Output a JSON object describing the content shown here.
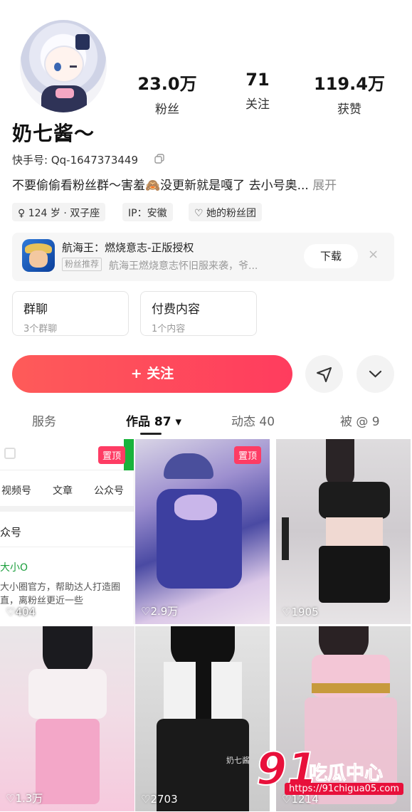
{
  "profile": {
    "name": "奶七酱～",
    "kuaishou_id": "快手号: Qq-1647373449",
    "bio": "不要偷偷看粉丝群～害羞🙈没更新就是嘎了 去小号奥...",
    "bio_more": "展开",
    "stats": [
      {
        "num": "23.0万",
        "label": "粉丝"
      },
      {
        "num": "71",
        "label": "关注"
      },
      {
        "num": "119.4万",
        "label": "获赞"
      }
    ],
    "tags": [
      "♀ 124 岁 · 双子座",
      "IP：安徽",
      "♡ 她的粉丝团"
    ]
  },
  "ad": {
    "title": "航海王：燃烧意志-正版授权",
    "badge": "粉丝推荐",
    "desc": "航海王燃烧意志怀旧服来袭，爷...",
    "download": "下载",
    "close": "×"
  },
  "boxes": [
    {
      "title": "群聊",
      "sub": "3个群聊"
    },
    {
      "title": "付费内容",
      "sub": "1个内容"
    }
  ],
  "actions": {
    "follow": "+ 关注"
  },
  "tabs": [
    {
      "label": "服务"
    },
    {
      "label": "作品 87 ▾"
    },
    {
      "label": "动态 40"
    },
    {
      "label": "被 @ 9"
    }
  ],
  "grid": {
    "pin_label": "置顶",
    "first_cell": {
      "tabs": [
        "视频号",
        "文章",
        "公众号"
      ],
      "heading": "众号",
      "name": "大小O",
      "line1": "大小圈官方，帮助达人打造圈",
      "line2": "直，离粉丝更近一些"
    },
    "items": [
      {
        "likes": "♡404"
      },
      {
        "likes": "♡2.9万"
      },
      {
        "likes": "♡1905"
      },
      {
        "likes": "♡1.3万"
      },
      {
        "likes": "♡2703"
      },
      {
        "likes": "♡1214"
      }
    ],
    "caption": "奶七酱"
  },
  "watermark": {
    "num": "91",
    "text": "吃瓜中心",
    "url": "https://91chigua05.com"
  }
}
